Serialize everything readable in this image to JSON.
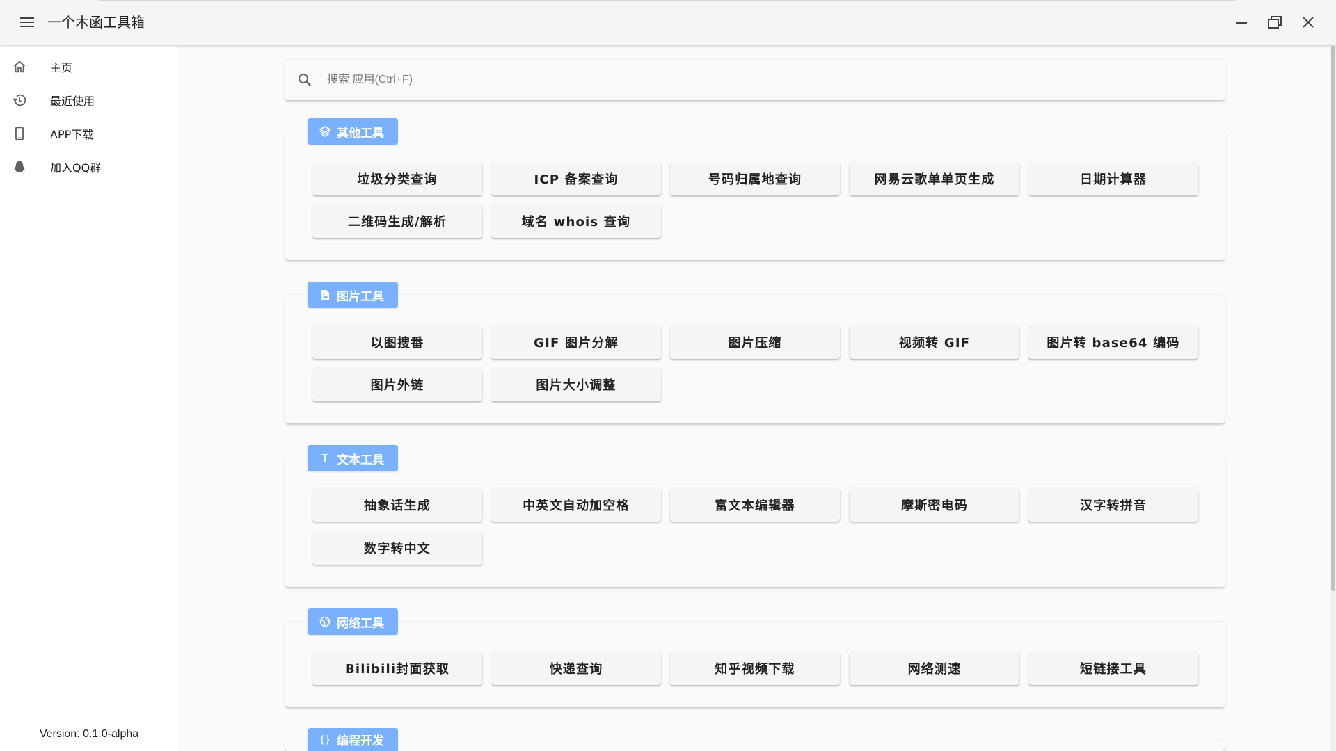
{
  "app": {
    "title": "一个木函工具箱",
    "accent_color": "#7ab1ff",
    "icons": {
      "menu": "menu-icon",
      "minimize": "minimize-icon",
      "maximize": "maximize-icon",
      "close": "close-icon"
    }
  },
  "sidebar": {
    "items": [
      {
        "label": "主页",
        "icon": "home-icon"
      },
      {
        "label": "最近使用",
        "icon": "history-icon"
      },
      {
        "label": "APP下载",
        "icon": "phone-icon"
      },
      {
        "label": "加入QQ群",
        "icon": "qq-icon"
      }
    ],
    "version": "Version: 0.1.0-alpha"
  },
  "search": {
    "placeholder": "搜索 应用(Ctrl+F)",
    "value": "",
    "icon": "search-icon"
  },
  "categories": [
    {
      "label": "其他工具",
      "icon": "layers-icon",
      "tools": [
        "垃圾分类查询",
        "ICP 备案查询",
        "号码归属地查询",
        "网易云歌单单页生成",
        "日期计算器",
        "二维码生成/解析",
        "域名 whois 查询"
      ]
    },
    {
      "label": "图片工具",
      "icon": "image-file-icon",
      "tools": [
        "以图搜番",
        "GIF 图片分解",
        "图片压缩",
        "视频转 GIF",
        "图片转 base64 编码",
        "图片外链",
        "图片大小调整"
      ]
    },
    {
      "label": "文本工具",
      "icon": "text-icon",
      "tools": [
        "抽象话生成",
        "中英文自动加空格",
        "富文本编辑器",
        "摩斯密电码",
        "汉字转拼音",
        "数字转中文"
      ]
    },
    {
      "label": "网络工具",
      "icon": "globe-icon",
      "tools": [
        "Bilibili封面获取",
        "快递查询",
        "知乎视频下载",
        "网络测速",
        "短链接工具"
      ]
    },
    {
      "label": "编程开发",
      "icon": "code-braces-icon",
      "tools": []
    }
  ]
}
